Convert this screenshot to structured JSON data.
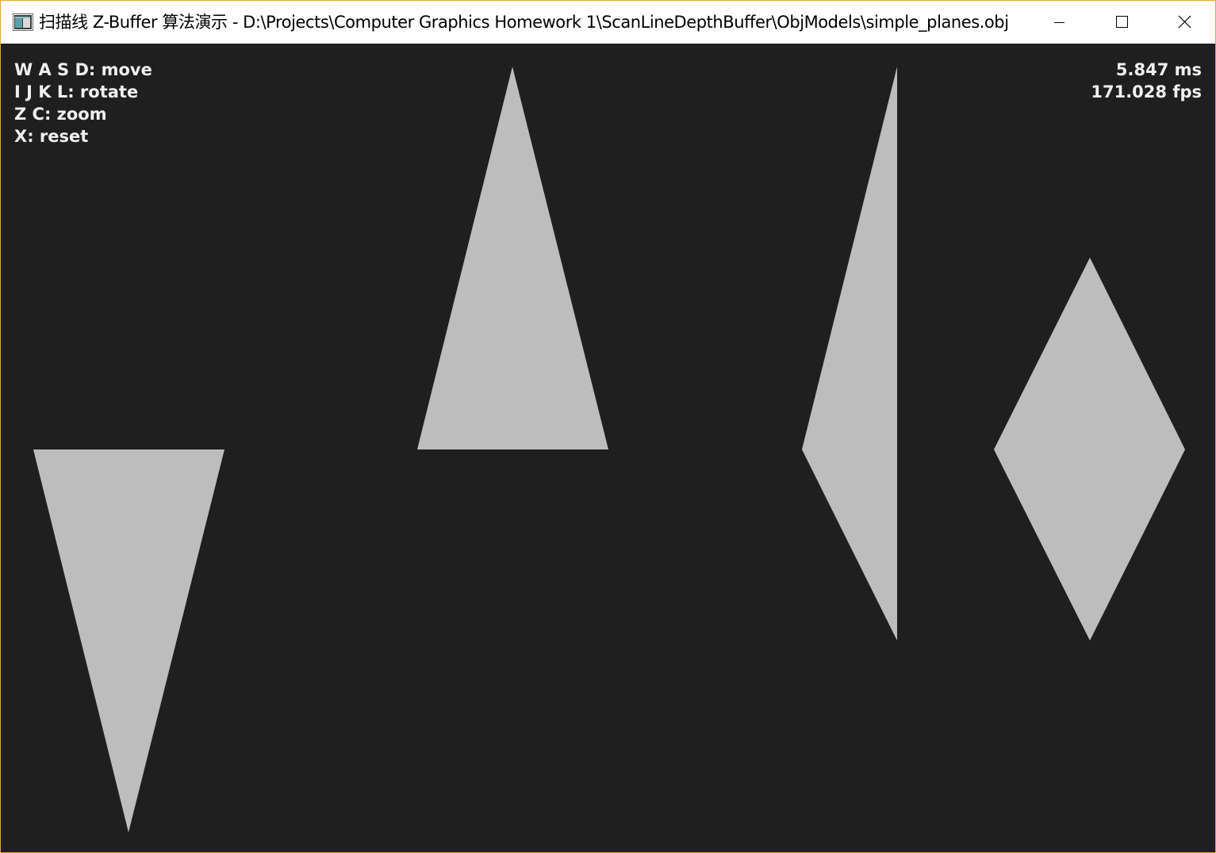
{
  "window": {
    "title": "扫描线 Z-Buffer 算法演示 - D:\\Projects\\Computer Graphics Homework 1\\ScanLineDepthBuffer\\ObjModels\\simple_planes.obj",
    "icon": "app-window-icon",
    "controls": {
      "minimize_icon": "minimize-icon",
      "maximize_icon": "maximize-icon",
      "close_icon": "close-icon"
    },
    "border_color": "#e8a33d"
  },
  "viewport": {
    "background_color": "#1f1f1f",
    "shape_color": "#bdbdbd",
    "help": [
      "W A S D: move",
      "I J K L: rotate",
      "Z C: zoom",
      "X: reset"
    ],
    "stats": {
      "frame_time": "5.847 ms",
      "fps": "171.028 fps"
    }
  }
}
